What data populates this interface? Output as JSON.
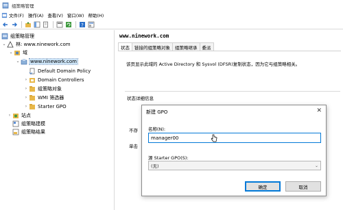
{
  "app": {
    "title": "组策略管理"
  },
  "menu": [
    {
      "label": "文件(F)",
      "icon": "console-icon"
    },
    {
      "label": "操作(A)"
    },
    {
      "label": "查看(V)"
    },
    {
      "label": "窗口(W)",
      "icon": "window-icon"
    },
    {
      "label": "帮助(H)"
    }
  ],
  "toolbar": [
    "back-icon",
    "forward-icon",
    "up-folder-icon",
    "show-tree-icon",
    "copy-icon",
    "export-icon",
    "refresh-icon",
    "help-icon",
    "properties-icon"
  ],
  "tree": {
    "root": "组策略管理",
    "forest": "林: www.ninework.com",
    "domains": "域",
    "domain": "www.ninework.com",
    "items": [
      "Default Domain Policy",
      "Domain Controllers",
      "组策略对象",
      "WMI 筛选器",
      "Starter GPO"
    ],
    "sites": "站点",
    "modeling": "组策略建模",
    "results": "组策略结果"
  },
  "main": {
    "title": "www.ninework.com",
    "tabs": [
      "状态",
      "链接的组策略对象",
      "组策略继承",
      "委派"
    ],
    "info": "该页显示此域的 Active Directory 和 Sysvol (DFSR)复制状态，因为它与组策略相关。",
    "detail_label": "状态详细信息",
    "side_text_1": "不存",
    "side_text_2": "单击"
  },
  "dialog": {
    "title": "新建 GPO",
    "name_label": "名称(N):",
    "name_value": "manager00",
    "starter_label": "源 Starter GPO(S):",
    "starter_value": "(无)",
    "ok": "确定",
    "cancel": "取消"
  },
  "colors": {
    "accent": "#0078d7",
    "selection": "#cce4f7",
    "folder": "#e8b84a"
  }
}
